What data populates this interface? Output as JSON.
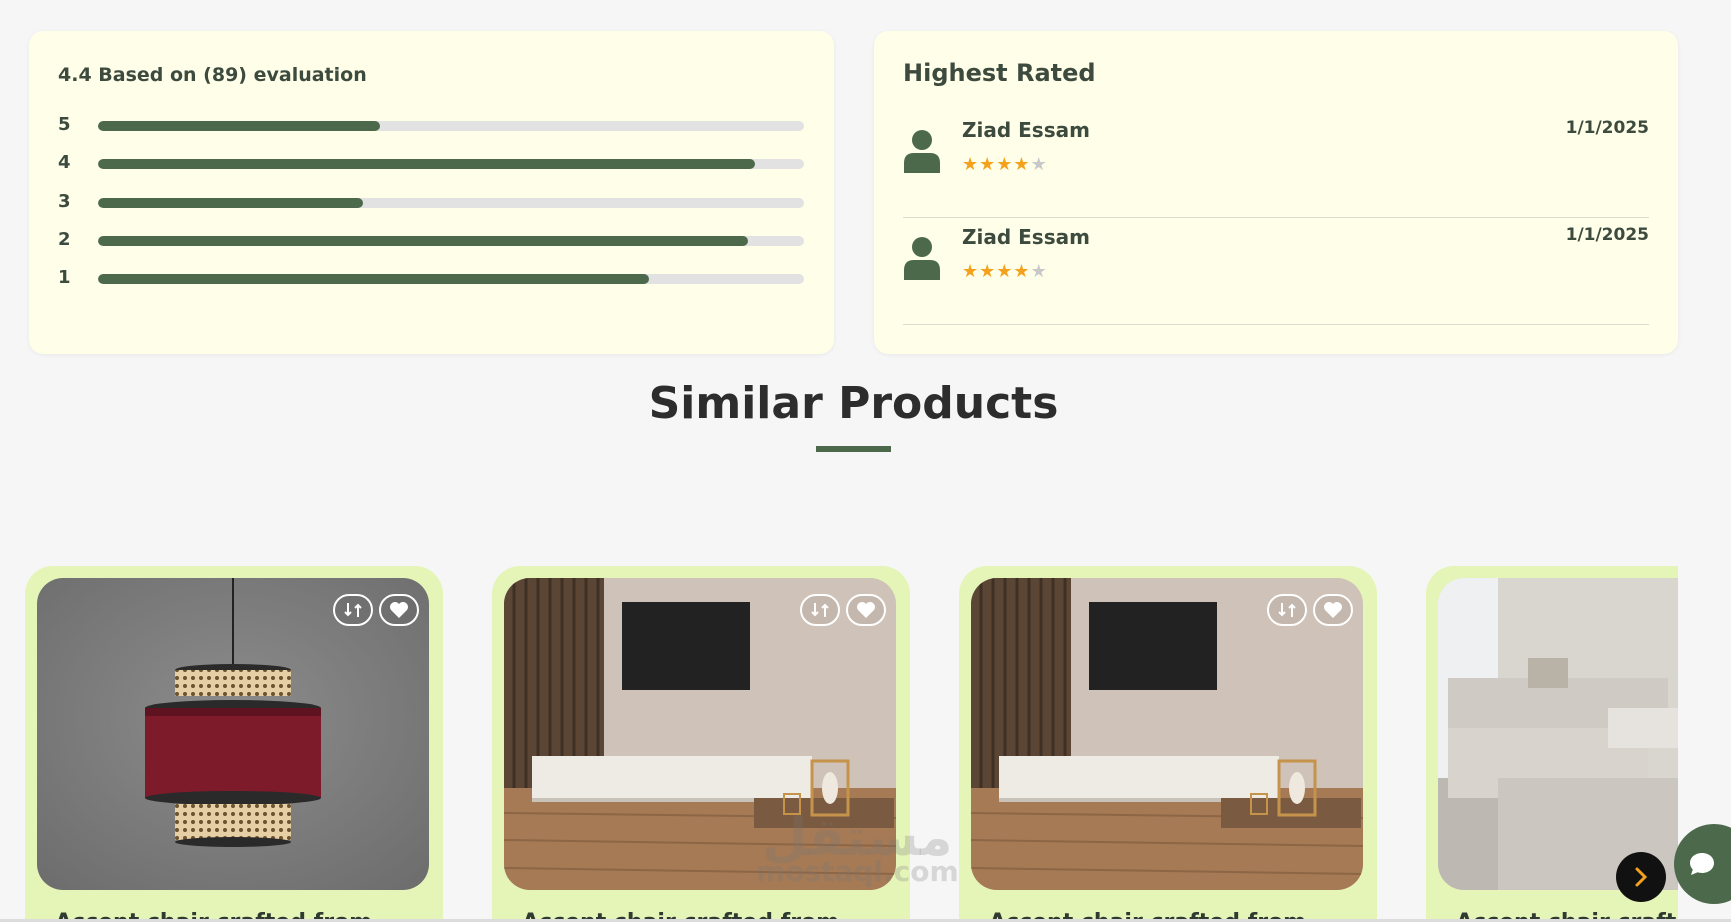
{
  "rating": {
    "summary": "4.4 Based on (89) evaluation",
    "bars": [
      {
        "label": "5",
        "fraction": 0.4
      },
      {
        "label": "4",
        "fraction": 0.93
      },
      {
        "label": "3",
        "fraction": 0.375
      },
      {
        "label": "2",
        "fraction": 0.92
      },
      {
        "label": "1",
        "fraction": 0.78
      }
    ]
  },
  "reviews": {
    "title": "Highest Rated",
    "items": [
      {
        "name": "Ziad Essam",
        "date": "1/1/2025",
        "stars": 4,
        "max_stars": 5
      },
      {
        "name": "Ziad Essam",
        "date": "1/1/2025",
        "stars": 4,
        "max_stars": 5
      }
    ]
  },
  "similar": {
    "title": "Similar Products",
    "products": [
      {
        "title": "Accent chair crafted from",
        "image": "pendant-lamp"
      },
      {
        "title": "Accent chair crafted from",
        "image": "tv-console"
      },
      {
        "title": "Accent chair crafted from",
        "image": "tv-console"
      },
      {
        "title": "Accent chair crafted from",
        "image": "sectional-sofa"
      }
    ],
    "next_icon": "chevron-right-icon"
  },
  "chat": {
    "icon": "chat-bubble-icon"
  },
  "watermark": {
    "arabic": "مستقل",
    "latin": "mostaql.com"
  },
  "colors": {
    "accent": "#4c6a4b",
    "card_bg": "#fefee9",
    "product_bg": "#e5f5b8",
    "star": "#f4a21d",
    "star_empty": "#c8c8c8",
    "next_chevron": "#f4a21d"
  }
}
